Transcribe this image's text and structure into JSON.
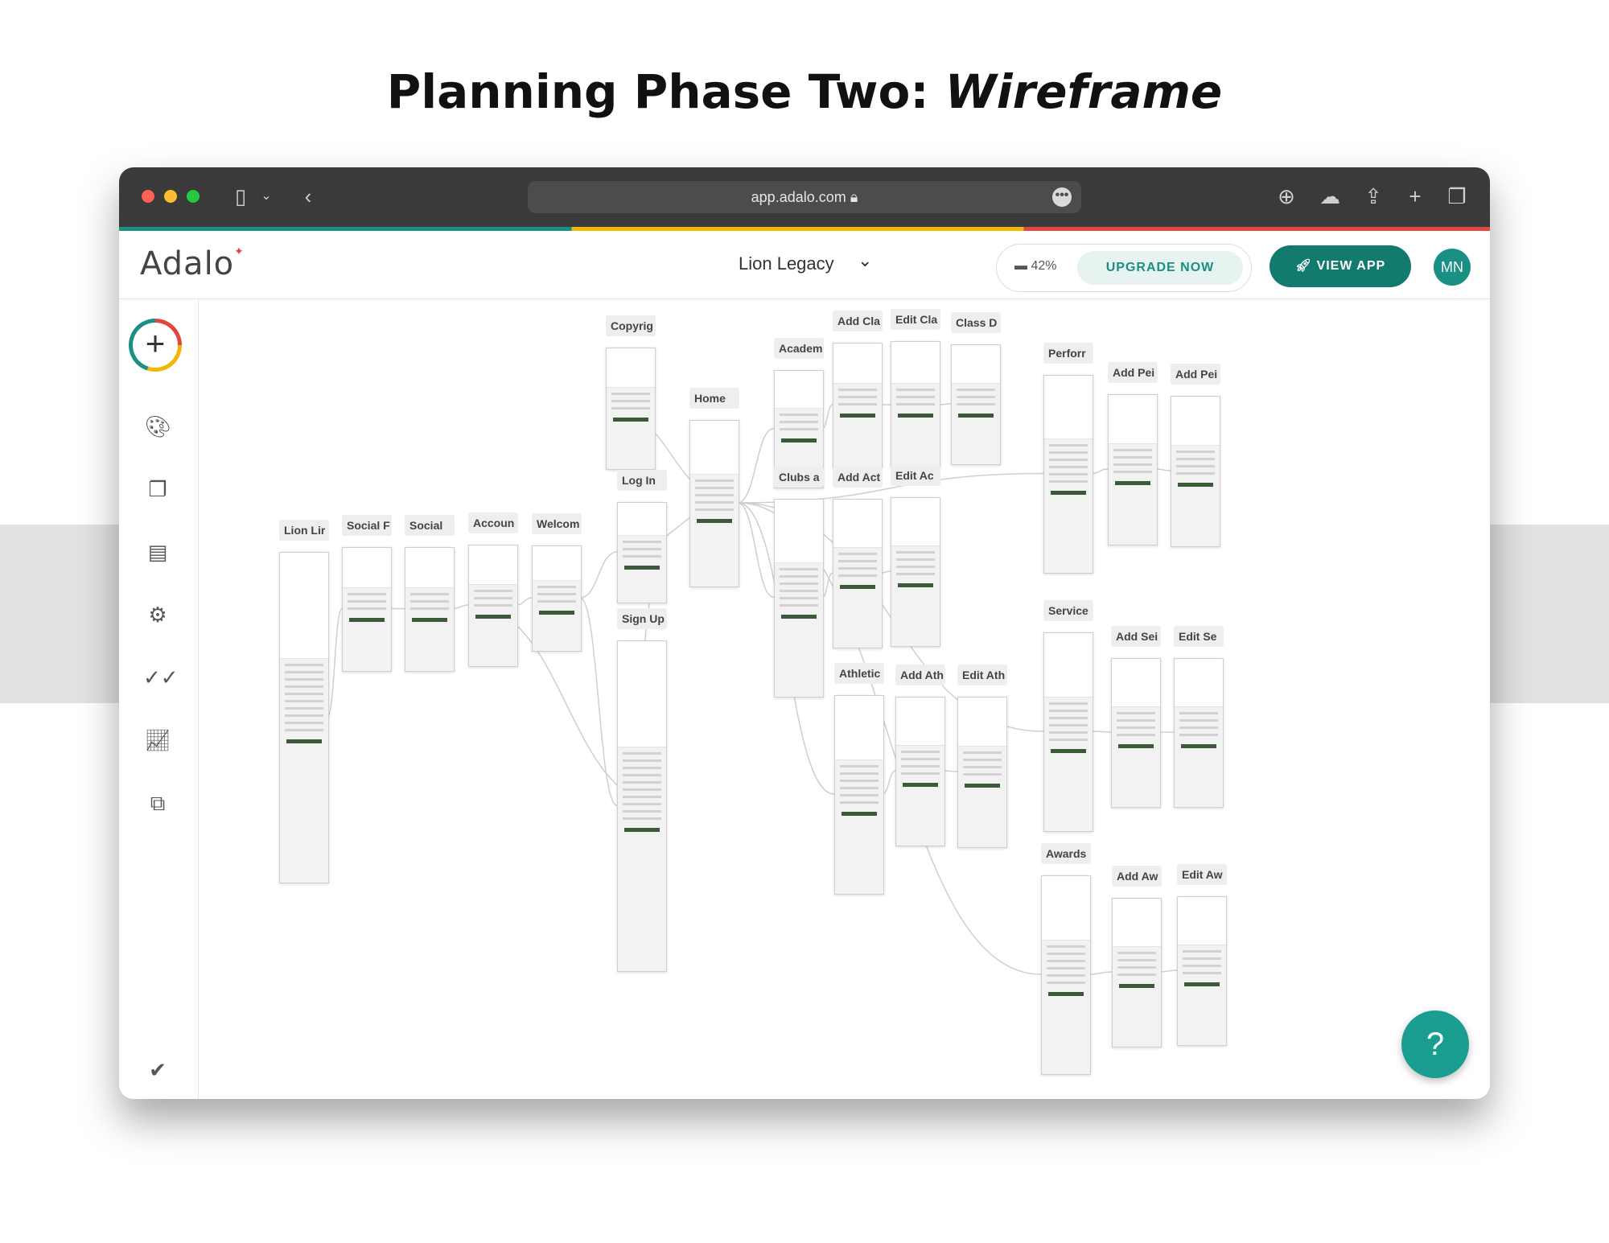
{
  "headline": {
    "prefix": "Planning Phase Two:",
    "emphasis": "Wireframe"
  },
  "browser": {
    "url": "app.adalo.com",
    "lock_icon": "lock-icon",
    "more_label": "•••"
  },
  "app": {
    "logo": "Adalo",
    "project_name": "Lion Legacy",
    "storage_percent": "42%",
    "upgrade_label": "UPGRADE NOW",
    "view_app_label": "VIEW APP",
    "avatar_initials": "MN"
  },
  "colors": {
    "accent": "#1a8f83",
    "view_app": "#137a6e",
    "red": "#e0483b",
    "yellow": "#f2b705"
  },
  "screens": [
    {
      "label": "Lion Lir"
    },
    {
      "label": "Social F"
    },
    {
      "label": "Social"
    },
    {
      "label": "Accoun"
    },
    {
      "label": "Welcom"
    },
    {
      "label": "Copyrig"
    },
    {
      "label": "Log In"
    },
    {
      "label": "Sign Up"
    },
    {
      "label": "Home"
    },
    {
      "label": "Academ"
    },
    {
      "label": "Add Cla"
    },
    {
      "label": "Edit Cla"
    },
    {
      "label": "Class D"
    },
    {
      "label": "Clubs a"
    },
    {
      "label": "Add Act"
    },
    {
      "label": "Edit Ac"
    },
    {
      "label": "Athletic"
    },
    {
      "label": "Add Ath"
    },
    {
      "label": "Edit Ath"
    },
    {
      "label": "Perforr"
    },
    {
      "label": "Add Pei"
    },
    {
      "label": "Add Pei"
    },
    {
      "label": "Service"
    },
    {
      "label": "Add Sei"
    },
    {
      "label": "Edit Se"
    },
    {
      "label": "Awards"
    },
    {
      "label": "Add Aw"
    },
    {
      "label": "Edit Aw"
    }
  ]
}
